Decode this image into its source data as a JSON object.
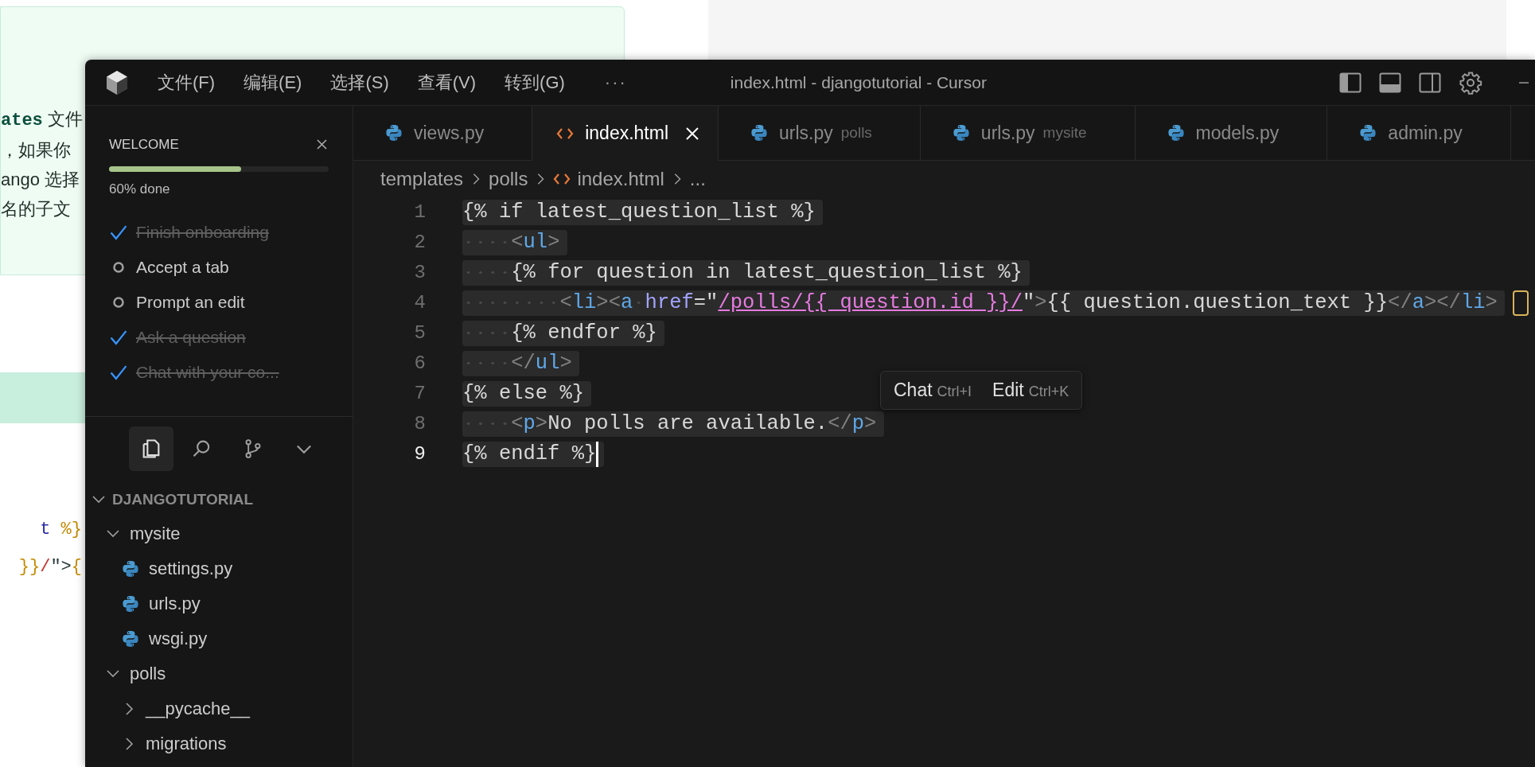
{
  "background_page": {
    "notes": [
      {
        "kind": "code",
        "text": "ates"
      },
      {
        "kind": "plain",
        "text": " 文件"
      }
    ],
    "lines": [
      "，如果你",
      "ango 选择",
      "名的子文"
    ],
    "code_lines": [
      [
        {
          "kind": "name",
          "text": "t"
        },
        {
          "kind": "delim",
          "text": " %}"
        }
      ],
      [
        {
          "kind": "delim",
          "text": "}}"
        },
        {
          "kind": "slash",
          "text": "/"
        },
        {
          "kind": "plain",
          "text": "\">"
        },
        {
          "kind": "delim",
          "text": "{"
        }
      ]
    ]
  },
  "window": {
    "title": "index.html - djangotutorial - Cursor",
    "menu": [
      "文件(F)",
      "编辑(E)",
      "选择(S)",
      "查看(V)",
      "转到(G)"
    ],
    "more": "···"
  },
  "welcome": {
    "title": "WELCOME",
    "level": 0.6,
    "progress_label": "60% done",
    "tasks": [
      {
        "label": "Finish onboarding",
        "done": true
      },
      {
        "label": "Accept a tab",
        "done": false
      },
      {
        "label": "Prompt an edit",
        "done": false
      },
      {
        "label": "Ask a question",
        "done": true
      },
      {
        "label": "Chat with your co...",
        "done": true
      }
    ]
  },
  "activity_bar": [
    {
      "kind": "files",
      "selected": true
    },
    {
      "kind": "search",
      "selected": false
    },
    {
      "kind": "branch",
      "selected": false
    },
    {
      "kind": "more",
      "selected": false
    }
  ],
  "explorer": {
    "title": "DJANGOTUTORIAL",
    "expanded": true,
    "tree": [
      {
        "label": "mysite",
        "kind": "folder",
        "expanded": true,
        "children": [
          {
            "label": "settings.py",
            "kind": "python"
          },
          {
            "label": "urls.py",
            "kind": "python"
          },
          {
            "label": "wsgi.py",
            "kind": "python"
          }
        ]
      },
      {
        "label": "polls",
        "kind": "folder",
        "expanded": true,
        "children": [
          {
            "label": "__pycache__",
            "kind": "folder",
            "expanded": false
          },
          {
            "label": "migrations",
            "kind": "folder",
            "expanded": false
          }
        ]
      }
    ]
  },
  "tabs": [
    {
      "label": "views.py",
      "kind": "python",
      "selected": false
    },
    {
      "label": "index.html",
      "kind": "html",
      "selected": true
    },
    {
      "label": "urls.py",
      "detail": "polls",
      "kind": "python",
      "selected": false
    },
    {
      "label": "urls.py",
      "detail": "mysite",
      "kind": "python",
      "selected": false
    },
    {
      "label": "models.py",
      "kind": "python",
      "selected": false
    },
    {
      "label": "admin.py",
      "kind": "python",
      "selected": false
    }
  ],
  "breadcrumb": [
    {
      "label": "templates",
      "kind": "folder"
    },
    {
      "label": "polls",
      "kind": "folder"
    },
    {
      "label": "index.html",
      "kind": "html"
    },
    {
      "label": "...",
      "kind": "more"
    }
  ],
  "editor": {
    "lines": [
      {
        "number": "1",
        "current": false,
        "marker": false,
        "tokens": [
          {
            "kind": "tmpl",
            "text": "{% if latest_question_list %}"
          }
        ]
      },
      {
        "number": "2",
        "current": false,
        "marker": false,
        "tokens": [
          {
            "kind": "punct",
            "text": "    <"
          },
          {
            "kind": "tag",
            "text": "ul"
          },
          {
            "kind": "punct",
            "text": ">"
          }
        ]
      },
      {
        "number": "3",
        "current": false,
        "marker": false,
        "tokens": [
          {
            "kind": "tmpl",
            "text": "    {% for question in latest_question_list %}"
          }
        ]
      },
      {
        "number": "4",
        "current": false,
        "tokens": [
          {
            "kind": "punct",
            "text": "        <"
          },
          {
            "kind": "tag",
            "text": "li"
          },
          {
            "kind": "punct",
            "text": "><"
          },
          {
            "kind": "tag",
            "text": "a"
          },
          {
            "kind": "attr",
            "text": " href"
          },
          {
            "kind": "tmpl",
            "text": "=\""
          },
          {
            "kind": "link",
            "text": "/polls/{{ question.id }}/"
          },
          {
            "kind": "tmpl",
            "text": "\""
          },
          {
            "kind": "punct",
            "text": ">"
          },
          {
            "kind": "tmpl",
            "text": "{{ question.question_text }}"
          },
          {
            "kind": "punct",
            "text": "</"
          },
          {
            "kind": "tag",
            "text": "a"
          },
          {
            "kind": "punct",
            "text": "></"
          },
          {
            "kind": "tag",
            "text": "li"
          },
          {
            "kind": "punct",
            "text": ">"
          }
        ],
        "marker": true
      },
      {
        "number": "5",
        "current": false,
        "marker": false,
        "tokens": [
          {
            "kind": "tmpl",
            "text": "    {% endfor %}"
          }
        ]
      },
      {
        "number": "6",
        "current": false,
        "marker": false,
        "tokens": [
          {
            "kind": "punct",
            "text": "    </"
          },
          {
            "kind": "tag",
            "text": "ul"
          },
          {
            "kind": "punct",
            "text": ">"
          }
        ]
      },
      {
        "number": "7",
        "current": false,
        "marker": false,
        "tokens": [
          {
            "kind": "tmpl",
            "text": "{% else %}"
          }
        ]
      },
      {
        "number": "8",
        "current": false,
        "marker": false,
        "tokens": [
          {
            "kind": "punct",
            "text": "    <"
          },
          {
            "kind": "tag",
            "text": "p"
          },
          {
            "kind": "punct",
            "text": ">"
          },
          {
            "kind": "tmpl",
            "text": "No polls are available."
          },
          {
            "kind": "punct",
            "text": "</"
          },
          {
            "kind": "tag",
            "text": "p"
          },
          {
            "kind": "punct",
            "text": ">"
          }
        ]
      },
      {
        "number": "9",
        "current": true,
        "marker": false,
        "tokens": [
          {
            "kind": "tmpl",
            "text": "{% endif %}"
          }
        ]
      }
    ]
  },
  "inline_popup": {
    "items": [
      {
        "label": "Chat",
        "shortcut": "Ctrl+I"
      },
      {
        "label": "Edit",
        "shortcut": "Ctrl+K"
      }
    ]
  }
}
